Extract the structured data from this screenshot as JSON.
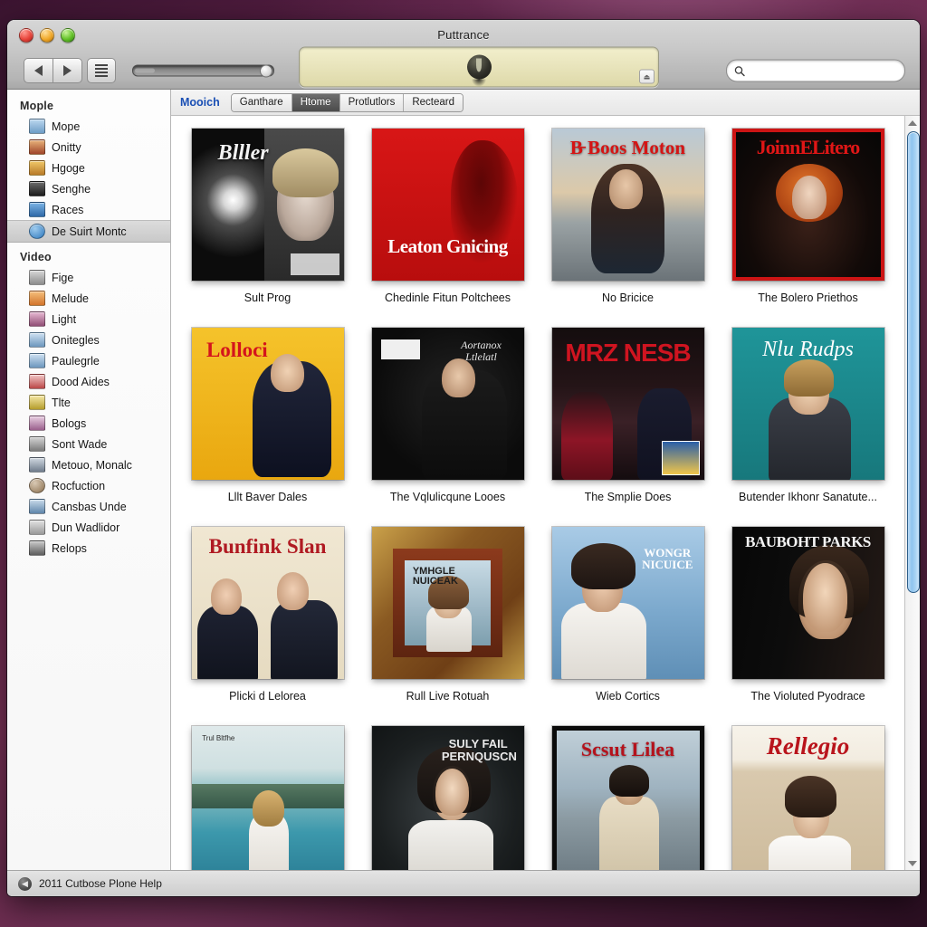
{
  "window": {
    "title": "Puttrance",
    "traffic_lights": [
      "close",
      "minimize",
      "zoom"
    ]
  },
  "toolbar": {
    "back_label": "Back",
    "forward_label": "Forward",
    "list_view_label": "List view",
    "slider_label": "Volume",
    "eject_icon": "eject-icon",
    "search": {
      "value": "",
      "placeholder": ""
    }
  },
  "tabbar": {
    "lead_label": "Mooich",
    "tabs": [
      {
        "label": "Ganthare",
        "active": false
      },
      {
        "label": "Htome",
        "active": true
      },
      {
        "label": "Protlutlors",
        "active": false
      },
      {
        "label": "Recteard",
        "active": false
      }
    ]
  },
  "sidebar": {
    "sections": [
      {
        "header": "Mople",
        "items": [
          {
            "label": "Mope",
            "icon": "note-icon",
            "color1": "#bcd8ef",
            "color2": "#6e9dc6",
            "selected": false
          },
          {
            "label": "Onitty",
            "icon": "sunset-icon",
            "color1": "#e8b27a",
            "color2": "#a0452a",
            "selected": false
          },
          {
            "label": "Hgoge",
            "icon": "picture-icon",
            "color1": "#f0c96a",
            "color2": "#b87a28",
            "selected": false
          },
          {
            "label": "Senghe",
            "icon": "film-icon",
            "color1": "#6d6d6d",
            "color2": "#1c1c1c",
            "selected": false
          },
          {
            "label": "Races",
            "icon": "radio-icon",
            "color1": "#7cb4e6",
            "color2": "#2f6aa8",
            "selected": false
          },
          {
            "label": "De Suirt Montc",
            "icon": "globe-icon",
            "color1": "#9ecbee",
            "color2": "#2d78bd",
            "selected": true
          }
        ]
      },
      {
        "header": "Video",
        "items": [
          {
            "label": "Fige",
            "icon": "document-icon",
            "color1": "#d8d8d8",
            "color2": "#8d8d8d",
            "selected": false
          },
          {
            "label": "Melude",
            "icon": "book-icon",
            "color1": "#f5bf7c",
            "color2": "#d2752c",
            "selected": false
          },
          {
            "label": "Light",
            "icon": "folder-icon",
            "color1": "#e8b9d3",
            "color2": "#8f4d74",
            "selected": false
          },
          {
            "label": "Onitegles",
            "icon": "playlist-icon",
            "color1": "#cfe2f2",
            "color2": "#6c97bd",
            "selected": false
          },
          {
            "label": "Paulegrle",
            "icon": "playlist-icon",
            "color1": "#cfe2f2",
            "color2": "#6c97bd",
            "selected": false
          },
          {
            "label": "Dood Aides",
            "icon": "waveform-icon",
            "color1": "#f2c8c8",
            "color2": "#bb4747",
            "selected": false
          },
          {
            "label": "Tlte",
            "icon": "text-icon",
            "color1": "#f6e9a8",
            "color2": "#b59d2c",
            "selected": false
          },
          {
            "label": "Bologs",
            "icon": "printer-icon",
            "color1": "#e9cfe2",
            "color2": "#9a5f8c",
            "selected": false
          },
          {
            "label": "Sont Wade",
            "icon": "image-icon",
            "color1": "#d4d4d4",
            "color2": "#7a7a7a",
            "selected": false
          },
          {
            "label": "Metouo, Monalc",
            "icon": "window-icon",
            "color1": "#cfd7e0",
            "color2": "#6f7c8c",
            "selected": false
          },
          {
            "label": "Rocfuction",
            "icon": "gear-icon",
            "color1": "#d9c9b4",
            "color2": "#8a6f4e",
            "selected": false
          },
          {
            "label": "Cansbas Unde",
            "icon": "page-icon",
            "color1": "#c8daea",
            "color2": "#5f86ab",
            "selected": false
          },
          {
            "label": "Dun Wadlidor",
            "icon": "drive-icon",
            "color1": "#e2e2e2",
            "color2": "#9a9a9a",
            "selected": false
          },
          {
            "label": "Relops",
            "icon": "archive-icon",
            "color1": "#c9c9c9",
            "color2": "#5d5d5d",
            "selected": false
          }
        ]
      }
    ]
  },
  "grid": {
    "items": [
      {
        "caption": "Sult Prog",
        "cover_title": "Blller",
        "style": "blackwhite-star"
      },
      {
        "caption": "Chedinle Fitun Poltchees",
        "cover_title": "Leaton Gnicing",
        "style": "red-silhouette"
      },
      {
        "caption": "No Bricice",
        "cover_title": "B̵ Boos Moton",
        "style": "beach-sunset"
      },
      {
        "caption": "The Bolero Priethos",
        "cover_title": "JoinnELitero",
        "style": "red-border-dark"
      },
      {
        "caption": "Lllt Baver Dales",
        "cover_title": "Lolloci",
        "style": "yellow-suit"
      },
      {
        "caption": "The Vqlulicqune Looes",
        "cover_title": "Aortanox Ltlelatl",
        "style": "dark-portrait"
      },
      {
        "caption": "The Smplie Does",
        "cover_title": "MRZ  NESB",
        "style": "night-duo"
      },
      {
        "caption": "Butender Ikhonr Sanatute...",
        "cover_title": "Nlu Rudps",
        "style": "teal-script"
      },
      {
        "caption": "Plicki d Lelorea",
        "cover_title": "Bunfink Slan",
        "style": "cream-couple"
      },
      {
        "caption": "Rull Live Rotuah",
        "cover_title": "YMHGLE NUICEAK",
        "style": "gold-frame"
      },
      {
        "caption": "Wieb Cortics",
        "cover_title": "WONGR NICUICE",
        "style": "blue-sky-man"
      },
      {
        "caption": "The Violuted Pyodrace",
        "cover_title": "BAUBOHT PARKS",
        "style": "black-portrait"
      },
      {
        "caption": "",
        "cover_title": "Trul Bltfhe",
        "style": "lake-scene"
      },
      {
        "caption": "",
        "cover_title": "SULY FAIL PERNQUSCN",
        "style": "dark-woman"
      },
      {
        "caption": "",
        "cover_title": "Scsut Lilea",
        "style": "city-man"
      },
      {
        "caption": "",
        "cover_title": "Rellegio",
        "style": "cream-portrait"
      }
    ]
  },
  "statusbar": {
    "icon": "back-circle-icon",
    "text": "2011 Cutbose Plone Help"
  }
}
